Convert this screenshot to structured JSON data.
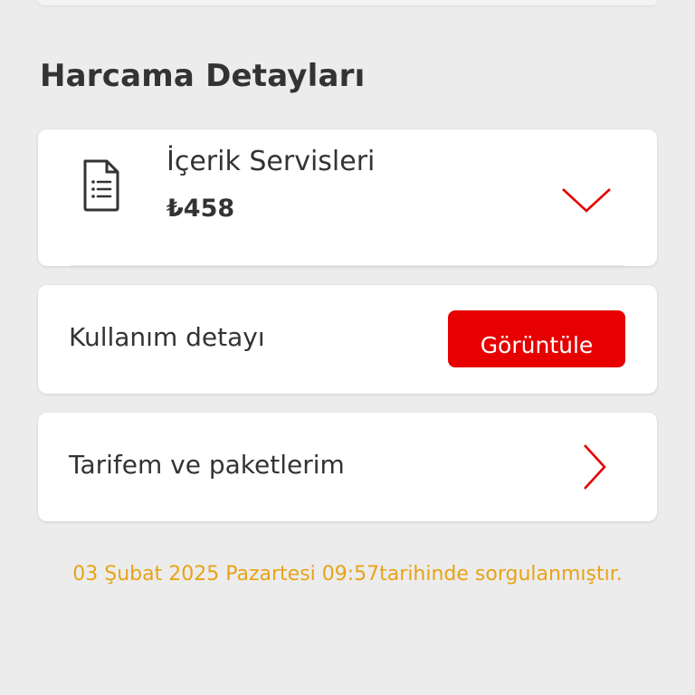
{
  "section": {
    "title": "Harcama Detayları"
  },
  "expand_card": {
    "icon": "document-list-icon",
    "name": "İçerik Servisleri",
    "amount": "₺458",
    "toggle_icon": "chevron-down-icon"
  },
  "usage_card": {
    "label": "Kullanım detayı",
    "button_label": "Görüntüle"
  },
  "tariff_card": {
    "label": "Tarifem ve paketlerim",
    "icon": "chevron-right-icon"
  },
  "footer": {
    "query_time": "03 Şubat 2025 Pazartesi 09:57tarihinde sorgulanmıştır."
  },
  "colors": {
    "background": "#ececec",
    "card": "#ffffff",
    "accent_red": "#e60000",
    "text": "#333333",
    "timestamp": "#e8a317"
  }
}
